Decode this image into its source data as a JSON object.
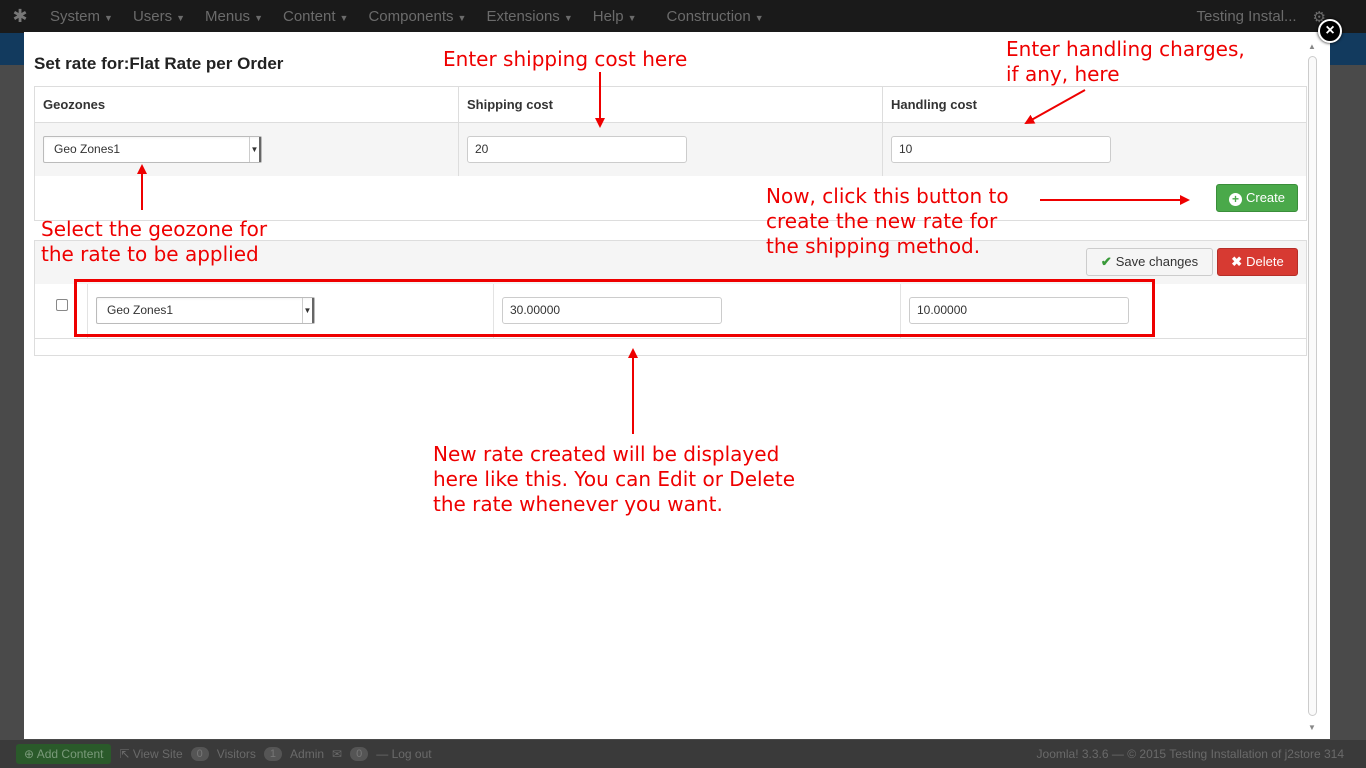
{
  "topbar": {
    "menu": [
      {
        "label": "System"
      },
      {
        "label": "Users"
      },
      {
        "label": "Menus"
      },
      {
        "label": "Content"
      },
      {
        "label": "Components"
      },
      {
        "label": "Extensions"
      },
      {
        "label": "Help"
      },
      {
        "label": "Construction"
      }
    ],
    "site_label": "Testing Instal...",
    "gear_icon": "gear-icon"
  },
  "footer": {
    "add_content": "Add Content",
    "view_site": "View Site",
    "visitors_count": "0",
    "visitors_label": "Visitors",
    "admin_count": "1",
    "admin_label": "Admin",
    "messages_count": "0",
    "logout": "Log out",
    "copyright": "Joomla! 3.3.6 — © 2015 Testing Installation of j2store 314"
  },
  "modal": {
    "title": "Set rate for:Flat Rate per Order",
    "close_label": "×",
    "columns": [
      "Geozones",
      "Shipping cost",
      "Handling cost"
    ],
    "new_rate": {
      "geozone": "Geo Zones1",
      "shipping_cost": "20",
      "handling_cost": "10"
    },
    "create_label": "Create",
    "save_label": "Save changes",
    "delete_label": "Delete",
    "rates": [
      {
        "geozone": "Geo Zones1",
        "shipping_cost": "30.00000",
        "handling_cost": "10.00000"
      }
    ]
  },
  "annotations": {
    "shipping": "Enter shipping cost here",
    "handling": "Enter handling charges,\nif any, here",
    "geozone": "Select the geozone for\nthe rate to be applied",
    "create": "Now, click this button to\ncreate the new rate for\nthe shipping method.",
    "created": "New rate created will be displayed\nhere like this. You can Edit or Delete\nthe rate whenever you want."
  },
  "colors": {
    "annotation": "#e00000",
    "create_button": "#4aa94a",
    "delete_button": "#d73a32"
  }
}
